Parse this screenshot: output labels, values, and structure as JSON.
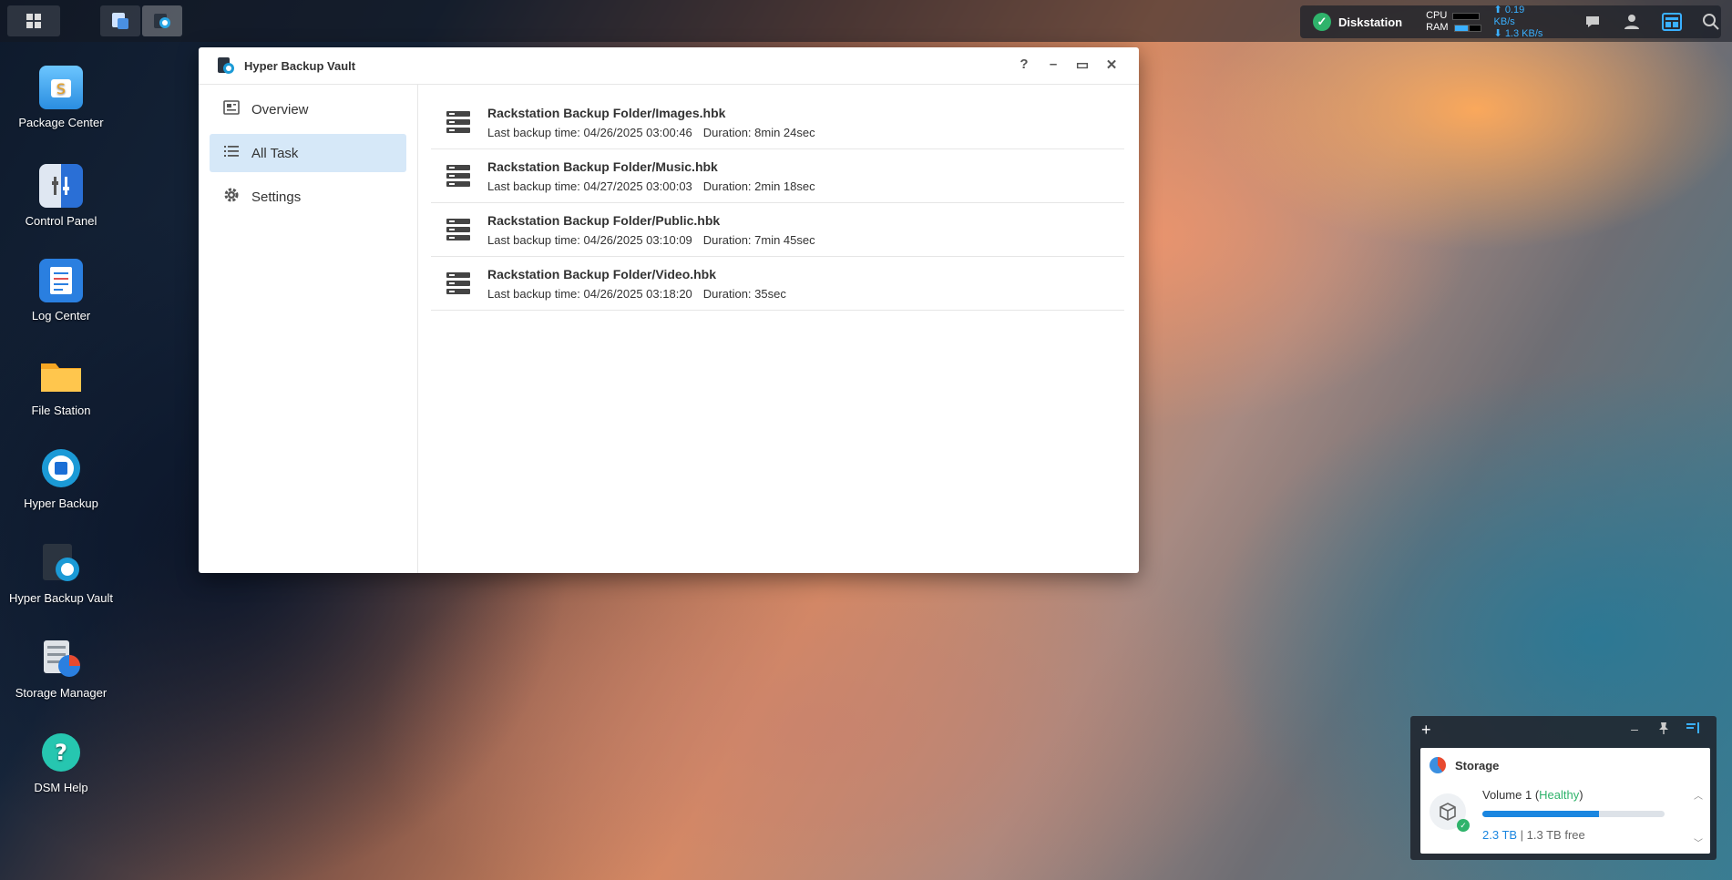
{
  "taskbar": {
    "apps": [
      "main-menu-icon",
      "hyper-backup-vault-running-icon"
    ],
    "status": {
      "server_name": "Diskstation",
      "cpu_label": "CPU",
      "ram_label": "RAM",
      "upload": "0.19 KB/s",
      "download": "1.3 KB/s"
    }
  },
  "desktop": {
    "icons": [
      {
        "label": "Package Center"
      },
      {
        "label": "Control Panel"
      },
      {
        "label": "Log Center"
      },
      {
        "label": "File Station"
      },
      {
        "label": "Hyper Backup"
      },
      {
        "label": "Hyper Backup Vault"
      },
      {
        "label": "Storage Manager"
      },
      {
        "label": "DSM Help"
      }
    ]
  },
  "window": {
    "title": "Hyper Backup Vault",
    "controls": {
      "help": "?",
      "minimize": "–",
      "maximize": "▭",
      "close": "✕"
    },
    "nav": [
      {
        "label": "Overview",
        "icon": "overview-icon",
        "selected": false
      },
      {
        "label": "All Task",
        "icon": "list-icon",
        "selected": true
      },
      {
        "label": "Settings",
        "icon": "gear-icon",
        "selected": false
      }
    ],
    "tasks": [
      {
        "name": "Rackstation Backup Folder/Images.hbk",
        "last_backup": "Last backup time: 04/26/2025 03:00:46",
        "duration": "Duration: 8min 24sec"
      },
      {
        "name": "Rackstation Backup Folder/Music.hbk",
        "last_backup": "Last backup time: 04/27/2025 03:00:03",
        "duration": "Duration: 2min 18sec"
      },
      {
        "name": "Rackstation Backup Folder/Public.hbk",
        "last_backup": "Last backup time: 04/26/2025 03:10:09",
        "duration": "Duration: 7min 45sec"
      },
      {
        "name": "Rackstation Backup Folder/Video.hbk",
        "last_backup": "Last backup time: 04/26/2025 03:18:20",
        "duration": "Duration: 35sec"
      }
    ]
  },
  "widget": {
    "title": "Storage",
    "volume": {
      "name": "Volume 1",
      "status": "Healthy",
      "used": "2.3 TB",
      "free": "1.3 TB free",
      "usage_fraction": 0.64
    }
  },
  "colors": {
    "accent": "#1a86e0",
    "healthy": "#2fb36b",
    "nav_selected": "#d6e8f8"
  }
}
